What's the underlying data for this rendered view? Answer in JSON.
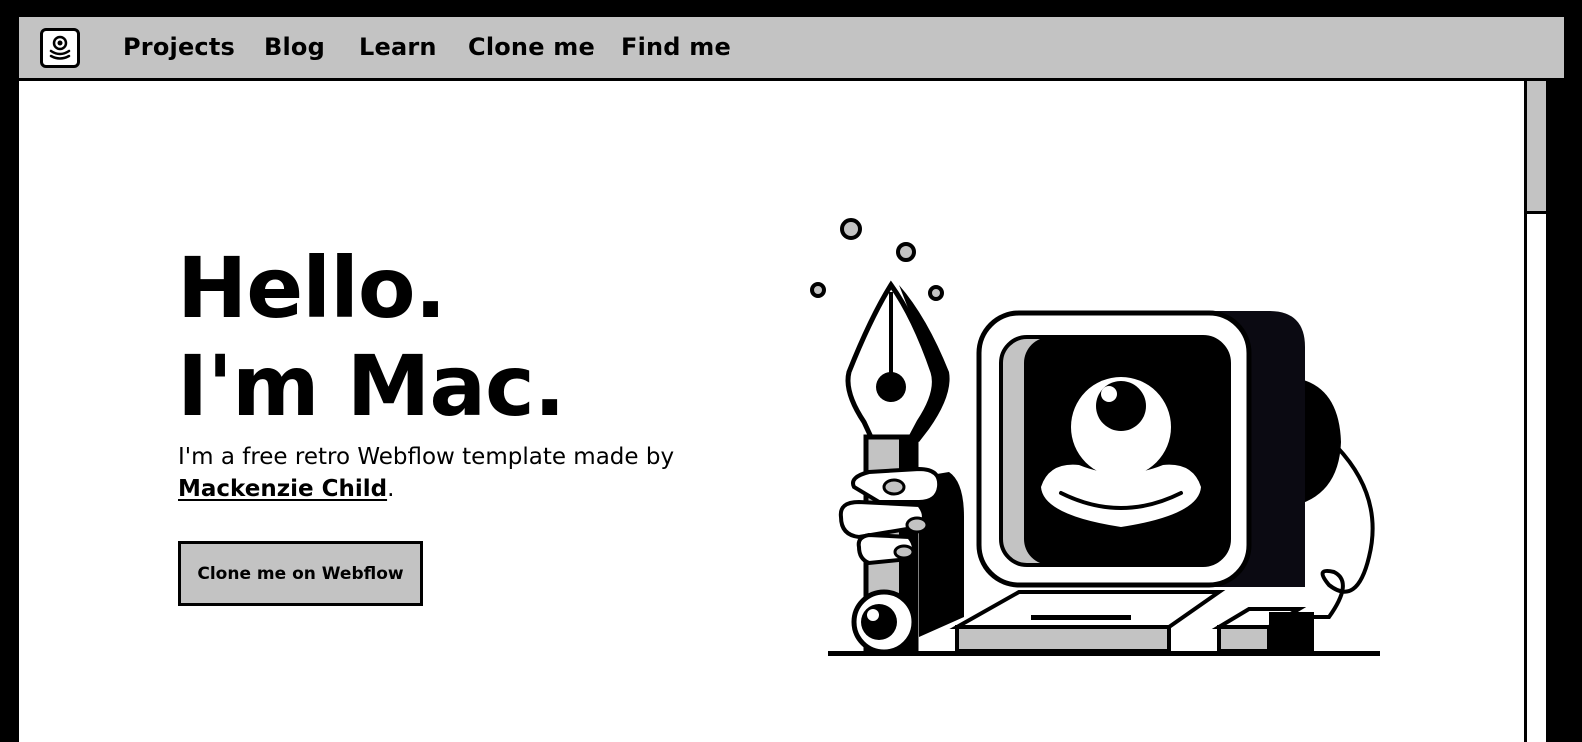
{
  "nav": {
    "logo_icon": "retro-eye-logo-icon",
    "links": [
      "Projects",
      "Blog",
      "Learn",
      "Clone me",
      "Find me"
    ]
  },
  "hero": {
    "title_line1": "Hello.",
    "title_line2": "I'm Mac.",
    "subtitle_text": "I'm a free retro Webflow template made by ",
    "author_link": "Mackenzie Child",
    "subtitle_end": ".",
    "cta_label": "Clone me on Webflow"
  },
  "illustration": {
    "icon": "retro-computer-with-pen-illustration"
  },
  "colors": {
    "background": "#000000",
    "page": "#ffffff",
    "nav_bg": "#c3c3c3",
    "ink": "#000000"
  }
}
